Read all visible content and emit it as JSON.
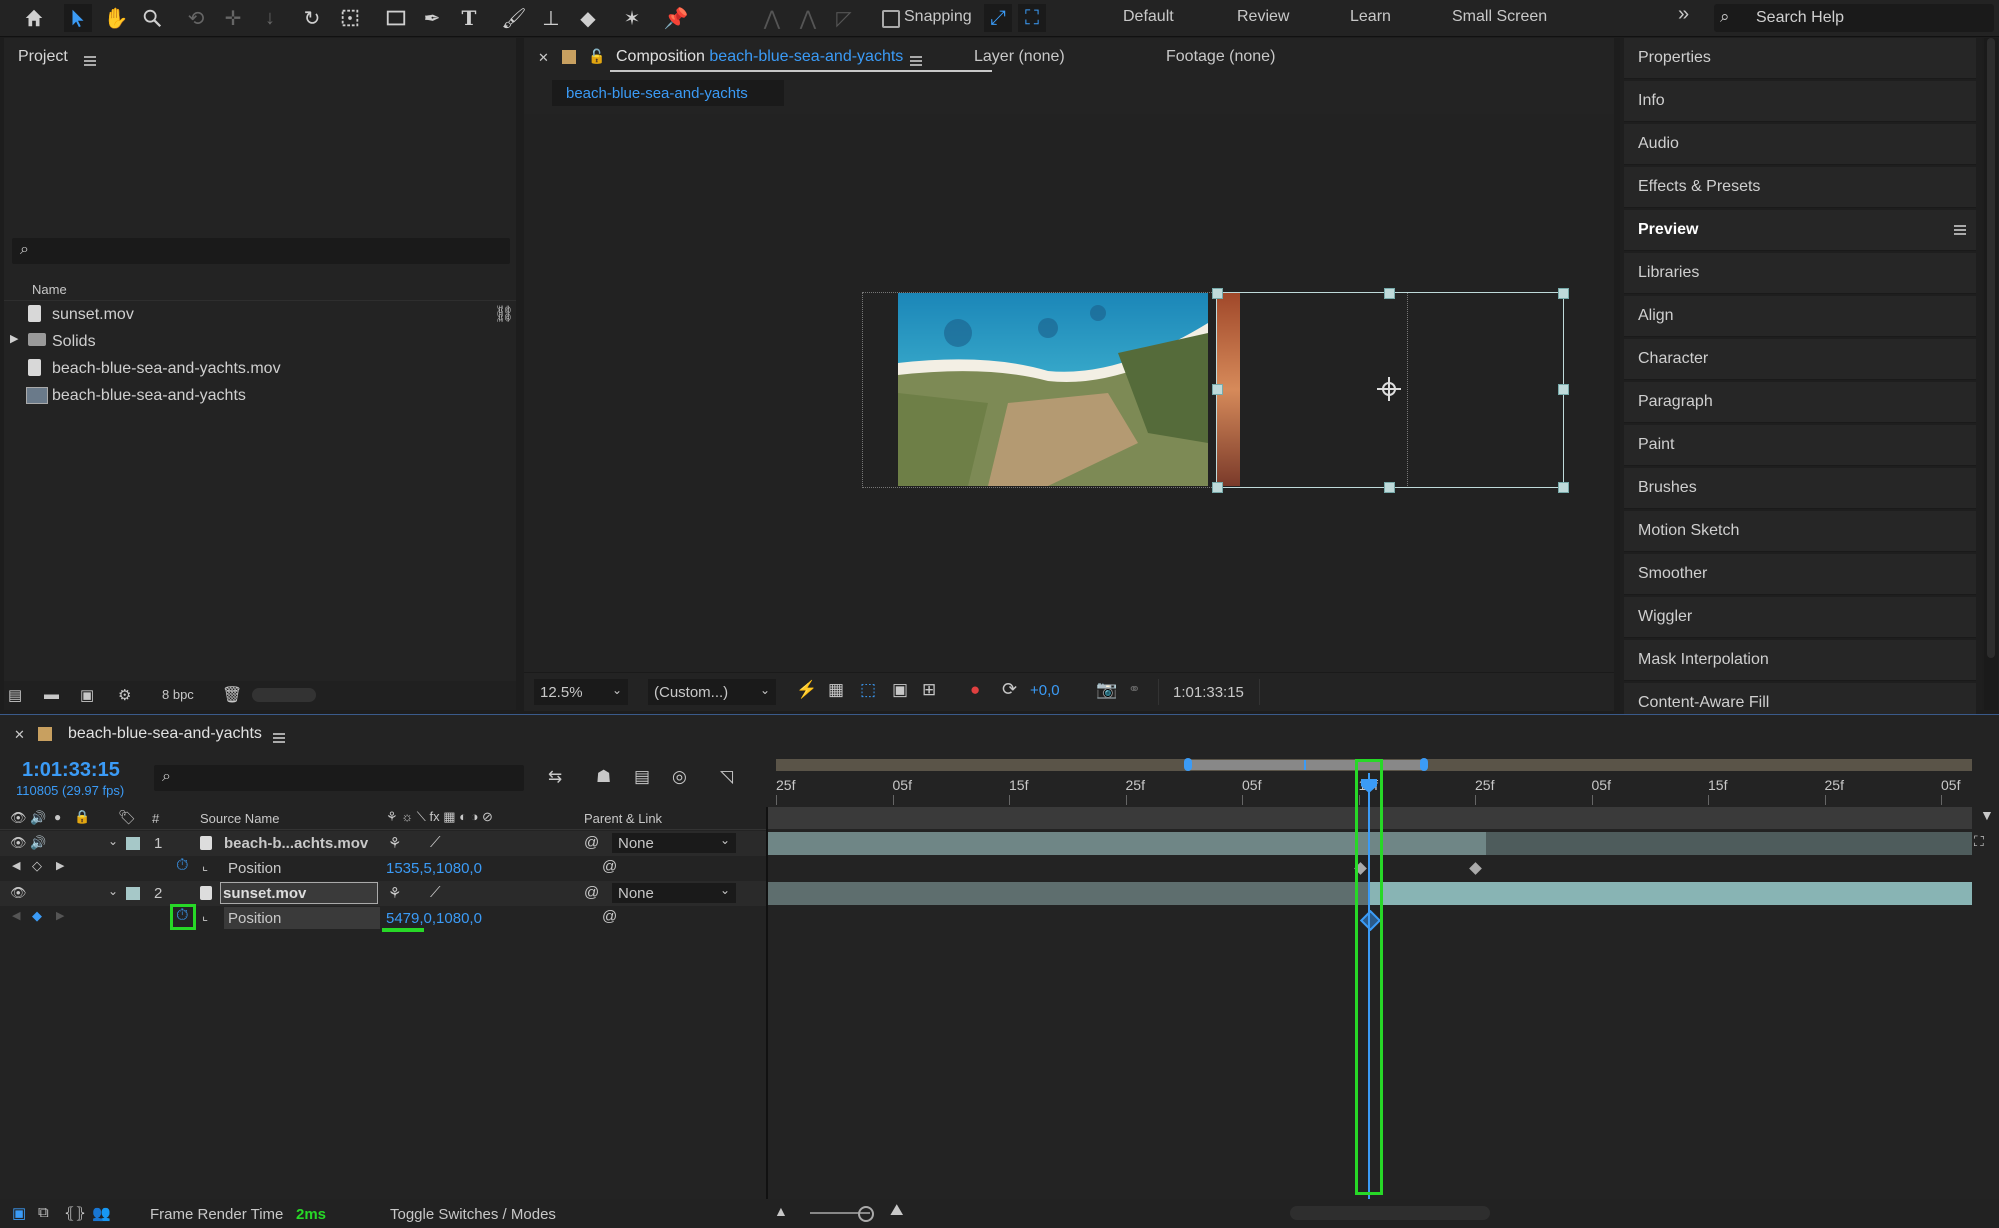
{
  "toolbar": {
    "snapping_label": "Snapping",
    "workspaces": [
      "Default",
      "Review",
      "Learn",
      "Small Screen"
    ],
    "more": "»",
    "search_placeholder": "Search Help"
  },
  "project": {
    "title": "Project",
    "column_name": "Name",
    "items": [
      {
        "name": "sunset.mov",
        "icon": "footage-icon"
      },
      {
        "name": "Solids",
        "icon": "folder-icon"
      },
      {
        "name": "beach-blue-sea-and-yachts.mov",
        "icon": "footage-icon"
      },
      {
        "name": "beach-blue-sea-and-yachts",
        "icon": "composition-icon"
      }
    ],
    "bpc": "8 bpc"
  },
  "composition": {
    "tab_prefix": "Composition",
    "tab_name": "beach-blue-sea-and-yachts",
    "layer_tab": "Layer (none)",
    "footage_tab": "Footage (none)",
    "sub_tab": "beach-blue-sea-and-yachts",
    "zoom": "12.5%",
    "resolution": "(Custom...)",
    "exposure": "+0,0",
    "timecode": "1:01:33:15"
  },
  "right_panel": {
    "items": [
      "Properties",
      "Info",
      "Audio",
      "Effects & Presets",
      "Preview",
      "Libraries",
      "Align",
      "Character",
      "Paragraph",
      "Paint",
      "Brushes",
      "Motion Sketch",
      "Smoother",
      "Wiggler",
      "Mask Interpolation",
      "Content-Aware Fill"
    ],
    "active": "Preview"
  },
  "timeline": {
    "comp_name": "beach-blue-sea-and-yachts",
    "timecode": "1:01:33:15",
    "frame_info": "110805 (29.97 fps)",
    "col_num": "#",
    "col_source": "Source Name",
    "col_parent": "Parent & Link",
    "ruler_labels": [
      "25f",
      "05f",
      "15f",
      "25f",
      "05f",
      "15f",
      "25f",
      "05f",
      "15f",
      "25f",
      "05f"
    ],
    "layers": [
      {
        "num": "1",
        "name": "beach-b...achts.mov",
        "parent": "None",
        "prop": "Position",
        "value": "1535,5,1080,0"
      },
      {
        "num": "2",
        "name": "sunset.mov",
        "parent": "None",
        "prop": "Position",
        "value": "5479,0,1080,0"
      }
    ],
    "footer_render_label": "Frame Render Time",
    "footer_render_value": "2ms",
    "footer_toggle": "Toggle Switches / Modes"
  },
  "colors": {
    "accent": "#3b9bf6",
    "highlight": "#27d827",
    "label": "#a6c8c8"
  }
}
